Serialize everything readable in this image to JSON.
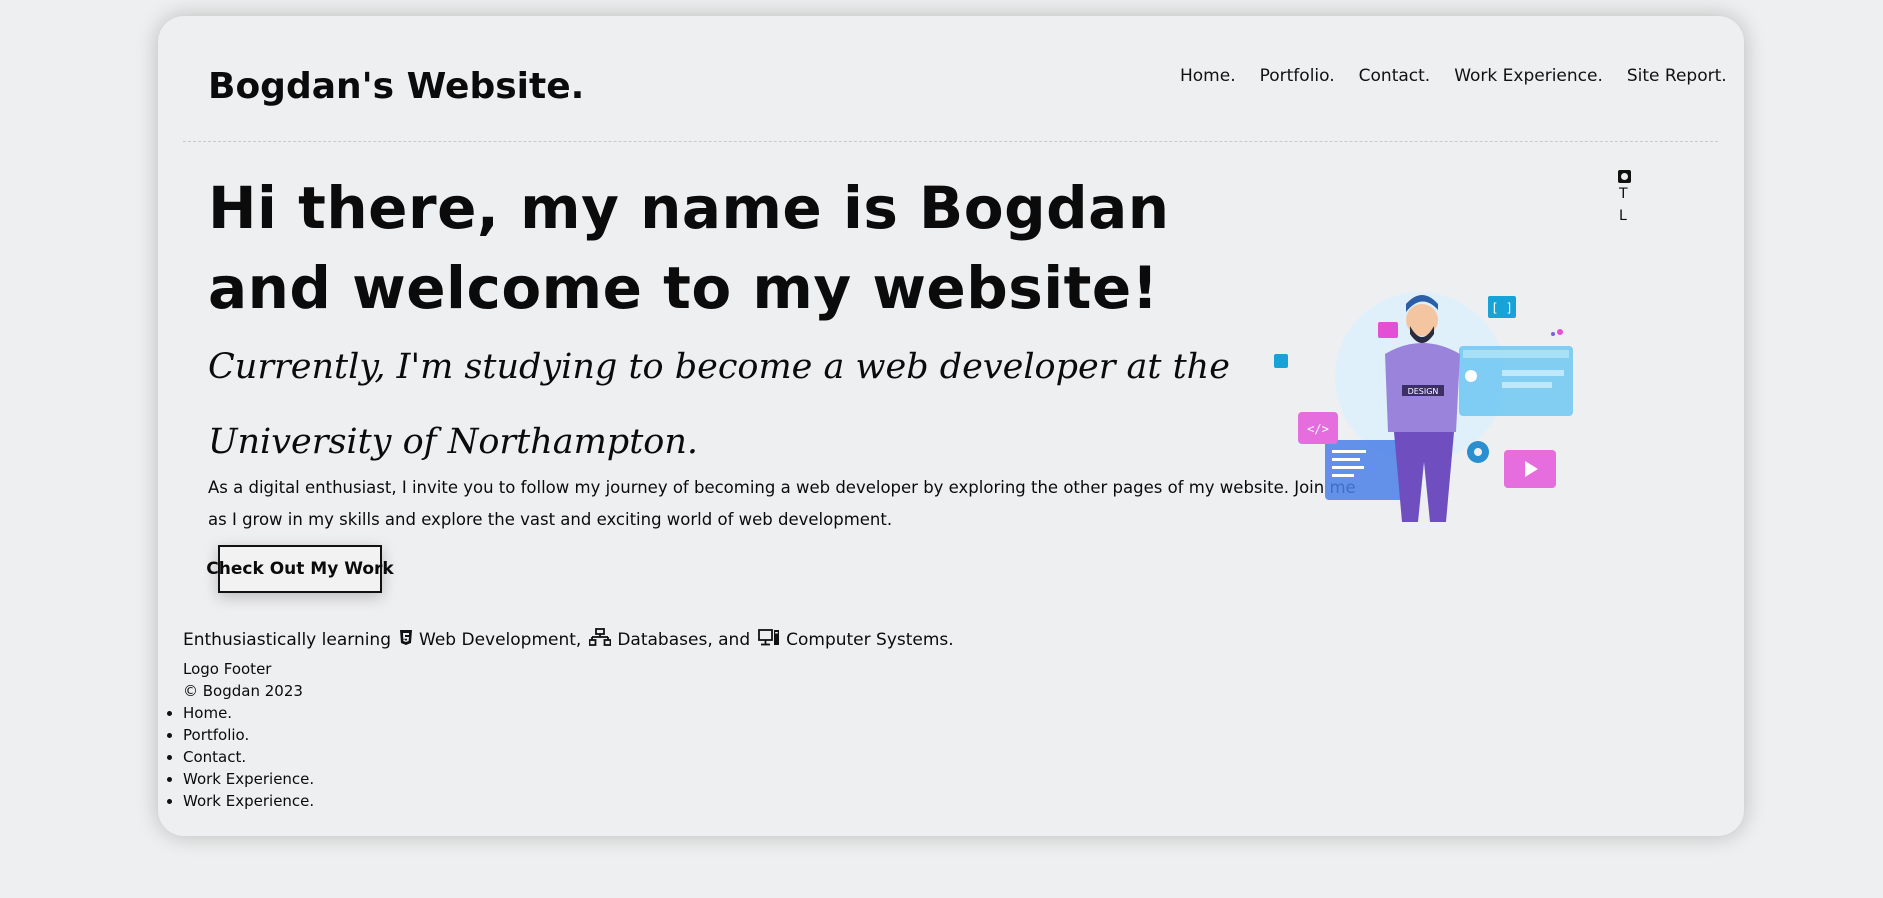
{
  "header": {
    "brand": "Bogdan's Website.",
    "nav": [
      "Home.",
      "Portfolio.",
      "Contact.",
      "Work Experience.",
      "Site Report."
    ]
  },
  "social": {
    "icon": "github-icon",
    "letters": [
      "T",
      "L"
    ]
  },
  "hero": {
    "title": "Hi there, my name is Bogdan and welcome to my website!",
    "subtitle": "Currently, I'm studying to become a web developer at the University of Northampton.",
    "body": "As a digital enthusiast, I invite you to follow my journey of becoming a web developer by exploring the other pages of my website. Join me as I grow in my skills and explore the vast and exciting world of web development.",
    "cta": "Check Out My Work",
    "illustration_badge": "DESIGN"
  },
  "skills": {
    "prefix": "Enthusiastically learning",
    "items": [
      {
        "label": "Web Development,",
        "icon": "html5-icon"
      },
      {
        "label": "Databases, and",
        "icon": "network-icon"
      },
      {
        "label": "Computer Systems.",
        "icon": "desktop-computer-icon"
      }
    ]
  },
  "footer": {
    "logo": "Logo Footer",
    "copyright": "© Bogdan 2023",
    "links": [
      "Home.",
      "Portfolio.",
      "Contact.",
      "Work Experience.",
      "Work Experience."
    ]
  },
  "colors": {
    "page_bg": "#eeeff0",
    "text": "#0b0b0b",
    "illus_purple": "#8a6fd1",
    "illus_pink": "#e44fd7",
    "illus_blue": "#3fb2e8"
  }
}
